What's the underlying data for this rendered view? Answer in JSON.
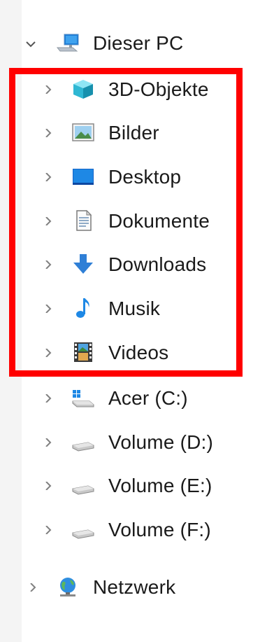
{
  "tree": {
    "root": {
      "label": "Dieser PC",
      "icon": "this-pc-icon",
      "expanded": true
    },
    "folders": [
      {
        "label": "3D-Objekte",
        "icon": "3d-objects-icon"
      },
      {
        "label": "Bilder",
        "icon": "pictures-icon"
      },
      {
        "label": "Desktop",
        "icon": "desktop-icon"
      },
      {
        "label": "Dokumente",
        "icon": "documents-icon"
      },
      {
        "label": "Downloads",
        "icon": "downloads-icon"
      },
      {
        "label": "Musik",
        "icon": "music-icon"
      },
      {
        "label": "Videos",
        "icon": "videos-icon"
      }
    ],
    "drives": [
      {
        "label": "Acer (C:)",
        "icon": "windows-drive-icon"
      },
      {
        "label": "Volume (D:)",
        "icon": "drive-icon"
      },
      {
        "label": "Volume (E:)",
        "icon": "drive-icon"
      },
      {
        "label": "Volume (F:)",
        "icon": "drive-icon"
      }
    ],
    "network": {
      "label": "Netzwerk",
      "icon": "network-icon"
    }
  },
  "colors": {
    "highlight_border": "#ff0000",
    "chevron": "#808080"
  }
}
